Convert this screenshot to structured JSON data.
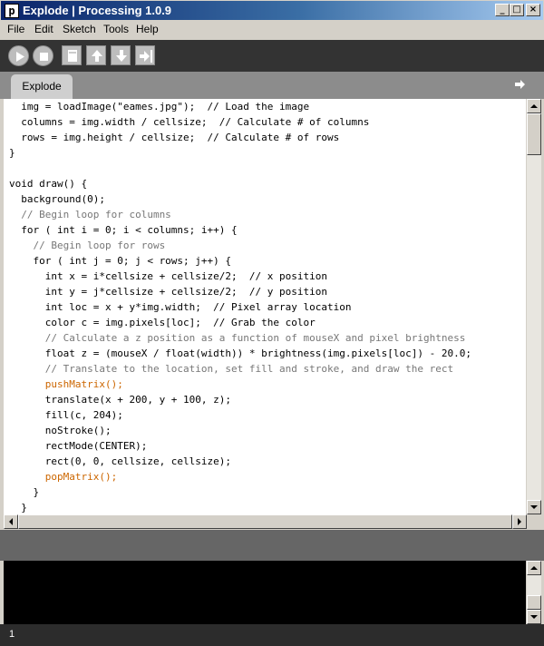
{
  "window": {
    "title": "Explode | Processing 1.0.9",
    "icon_letter": "p",
    "controls": {
      "minimize": "_",
      "maximize": "□",
      "close": "×"
    }
  },
  "menu": [
    "File",
    "Edit",
    "Sketch",
    "Tools",
    "Help"
  ],
  "toolbar": {
    "buttons": [
      "run-icon",
      "stop-icon",
      "new-icon",
      "open-icon",
      "save-icon",
      "export-icon"
    ]
  },
  "tabs": [
    {
      "label": "Explode"
    }
  ],
  "code": [
    "  img = loadImage(\"eames.jpg\");  // Load the image",
    "  columns = img.width / cellsize;  // Calculate # of columns",
    "  rows = img.height / cellsize;  // Calculate # of rows",
    "}",
    "",
    "void draw() {",
    "  background(0);",
    "  // Begin loop for columns",
    "  for ( int i = 0; i < columns; i++) {",
    "    // Begin loop for rows",
    "    for ( int j = 0; j < rows; j++) {",
    "      int x = i*cellsize + cellsize/2;  // x position",
    "      int y = j*cellsize + cellsize/2;  // y position",
    "      int loc = x + y*img.width;  // Pixel array location",
    "      color c = img.pixels[loc];  // Grab the color",
    "      // Calculate a z position as a function of mouseX and pixel brightness",
    "      float z = (mouseX / float(width)) * brightness(img.pixels[loc]) - 20.0;",
    "      // Translate to the location, set fill and stroke, and draw the rect",
    "      pushMatrix();",
    "      translate(x + 200, y + 100, z);",
    "      fill(c, 204);",
    "      noStroke();",
    "      rectMode(CENTER);",
    "      rect(0, 0, cellsize, cellsize);",
    "      popMatrix();",
    "    }",
    "  }"
  ],
  "status": {
    "line": "1"
  },
  "colors": {
    "toolbar": "#333333",
    "tabbar": "#8c8c8c",
    "console": "#000000",
    "keyword": "#cc6600",
    "comment": "#777777"
  }
}
